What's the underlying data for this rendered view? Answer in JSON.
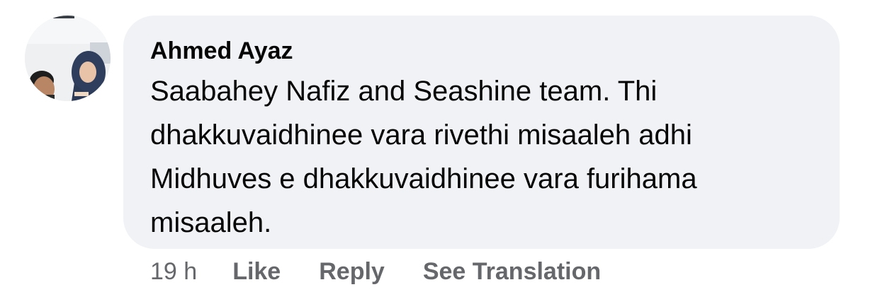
{
  "comment": {
    "author": "Ahmed Ayaz",
    "text": "Saabahey Nafiz and Seashine team. Thi dhakkuvaidhinee vara rivethi misaaleh adhi Midhuves e dhakkuvaidhinee vara furihama misaaleh.",
    "avatar_icon": "profile-photo",
    "timestamp": "19 h"
  },
  "actions": {
    "like": "Like",
    "reply": "Reply",
    "see_translation": "See Translation"
  },
  "colors": {
    "bubble": "#f0f2f5",
    "text": "#050505",
    "secondary": "#65676b"
  }
}
